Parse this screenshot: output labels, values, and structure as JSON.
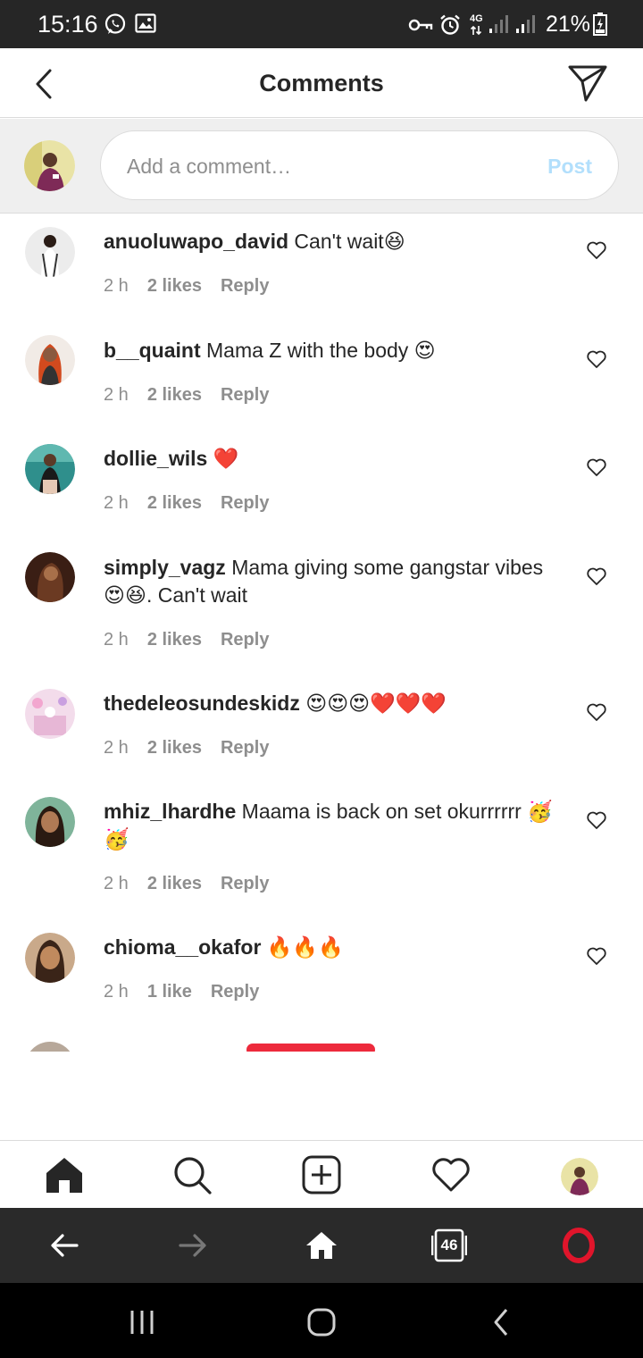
{
  "status_bar": {
    "time": "15:16",
    "battery": "21%",
    "network": "4G",
    "icons": [
      "whatsapp-icon",
      "gallery-icon",
      "vpn-key-icon",
      "alarm-icon",
      "signal-icon",
      "battery-icon"
    ]
  },
  "header": {
    "title": "Comments",
    "icons": [
      "back-arrow-icon",
      "send-icon"
    ]
  },
  "composer": {
    "placeholder": "Add a comment…",
    "post_label": "Post",
    "post_color": "#b2dffc"
  },
  "comments": [
    {
      "username": "anuoluwapo_david",
      "text": "Can't wait😆",
      "time": "2 h",
      "likes": "2 likes",
      "reply": "Reply"
    },
    {
      "username": "b__quaint",
      "text": "Mama Z with the body 😍",
      "time": "2 h",
      "likes": "2 likes",
      "reply": "Reply"
    },
    {
      "username": "dollie_wils",
      "text": "❤️",
      "time": "2 h",
      "likes": "2 likes",
      "reply": "Reply"
    },
    {
      "username": "simply_vagz",
      "text": "Mama giving some gangstar vibes😍😆. Can't wait",
      "time": "2 h",
      "likes": "2 likes",
      "reply": "Reply"
    },
    {
      "username": "thedeleosundeskidz",
      "text": "😍😍😍❤️❤️❤️",
      "time": "2 h",
      "likes": "2 likes",
      "reply": "Reply"
    },
    {
      "username": "mhiz_lhardhe",
      "text": "Maama is back on set okurrrrrr 🥳🥳",
      "time": "2 h",
      "likes": "2 likes",
      "reply": "Reply"
    },
    {
      "username": "chioma__okafor",
      "text": "🔥🔥🔥",
      "time": "2 h",
      "likes": "1 like",
      "reply": "Reply"
    }
  ],
  "bottom_nav": {
    "items": [
      "home-icon",
      "search-icon",
      "new-post-icon",
      "activity-heart-icon",
      "profile-avatar"
    ]
  },
  "browser_bar": {
    "tabs_count": "46",
    "items": [
      "browser-back-icon",
      "browser-forward-icon",
      "browser-home-icon",
      "tabs-icon",
      "opera-menu-icon"
    ]
  },
  "system_nav": {
    "items": [
      "recents-icon",
      "home-circle-icon",
      "back-chevron-icon"
    ]
  },
  "colors": {
    "status_bar": "#262626",
    "text": "#262626",
    "meta": "#8e8e8e",
    "heart_red": "#ed2a3c",
    "opera_red": "#e0152b",
    "browser_bar": "#2a2a2a"
  }
}
